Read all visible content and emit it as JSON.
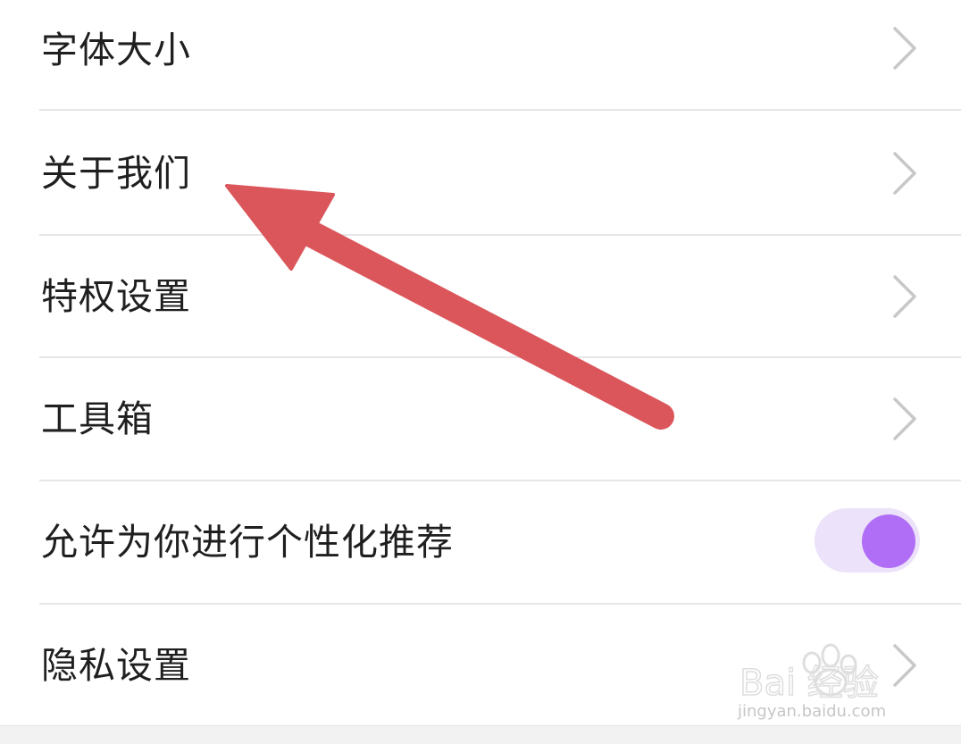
{
  "settings": {
    "items": [
      {
        "label": "字体大小",
        "control": "chevron"
      },
      {
        "label": "关于我们",
        "control": "chevron"
      },
      {
        "label": "特权设置",
        "control": "chevron"
      },
      {
        "label": "工具箱",
        "control": "chevron"
      },
      {
        "label": "允许为你进行个性化推荐",
        "control": "toggle",
        "toggle_on": true
      },
      {
        "label": "隐私设置",
        "control": "chevron"
      }
    ]
  },
  "colors": {
    "toggle_track": "#ece2f9",
    "toggle_knob": "#b06ef6",
    "annotation_arrow": "#db565b",
    "divider": "#e6e6e6"
  },
  "icons": {
    "chevron": "chevron-right-icon",
    "annotation": "red-arrow-annotation",
    "watermark": "baidu-paw-logo"
  },
  "watermark": {
    "brand_text": "Bai 经验",
    "url": "jingyan.baidu.com"
  }
}
